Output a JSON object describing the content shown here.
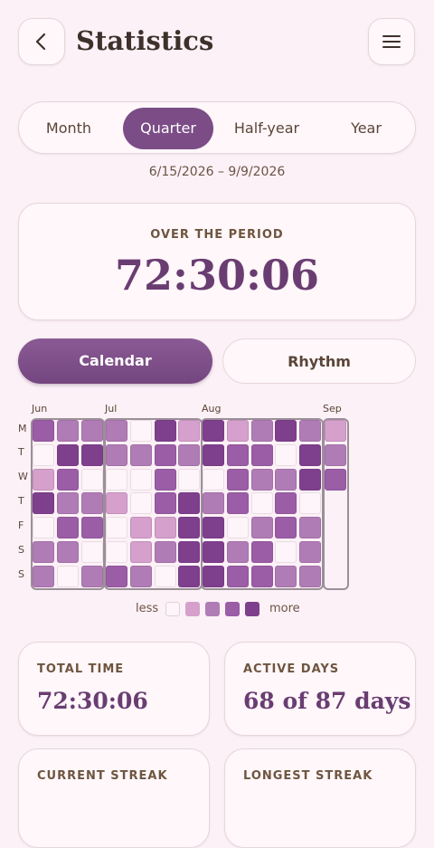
{
  "header": {
    "title": "Statistics"
  },
  "segments": [
    {
      "label": "Month",
      "active": false
    },
    {
      "label": "Quarter",
      "active": true
    },
    {
      "label": "Half-year",
      "active": false
    },
    {
      "label": "Year",
      "active": false
    }
  ],
  "date_range": "6/15/2026 – 9/9/2026",
  "period": {
    "label": "OVER THE PERIOD",
    "value": "72:30:06"
  },
  "view_tabs": {
    "calendar": "Calendar",
    "rhythm": "Rhythm",
    "active": "calendar"
  },
  "heatmap": {
    "months": [
      "Jun",
      "Jul",
      "Aug",
      "Sep"
    ],
    "day_labels": [
      "M",
      "T",
      "W",
      "T",
      "F",
      "S",
      "S"
    ],
    "levels": [
      "#fdf5f9",
      "#d5a0cc",
      "#b07cb6",
      "#9a5da6",
      "#7e3f8d"
    ],
    "blocks": [
      {
        "columns": [
          [
            3,
            0,
            1,
            4,
            0,
            2,
            2
          ],
          [
            2,
            4,
            3,
            2,
            3,
            2,
            0
          ],
          [
            2,
            4,
            0,
            2,
            3,
            0,
            2
          ]
        ]
      },
      {
        "columns": [
          [
            2,
            2,
            0,
            1,
            0,
            0,
            3
          ],
          [
            0,
            2,
            0,
            0,
            1,
            1,
            2
          ],
          [
            4,
            3,
            3,
            3,
            1,
            2,
            0
          ],
          [
            1,
            2,
            0,
            4,
            4,
            4,
            4
          ]
        ]
      },
      {
        "columns": [
          [
            4,
            4,
            0,
            2,
            4,
            4,
            4
          ],
          [
            1,
            3,
            3,
            3,
            0,
            2,
            3
          ],
          [
            2,
            3,
            2,
            0,
            2,
            3,
            3
          ],
          [
            4,
            0,
            2,
            3,
            3,
            0,
            2
          ],
          [
            2,
            4,
            4,
            0,
            2,
            2,
            2
          ]
        ]
      },
      {
        "columns": [
          [
            1,
            2,
            3,
            -1,
            -1,
            -1,
            -1
          ]
        ]
      }
    ],
    "legend": {
      "less": "less",
      "more": "more"
    }
  },
  "stats": [
    {
      "label": "TOTAL TIME",
      "value": "72:30:06"
    },
    {
      "label": "ACTIVE DAYS",
      "value": "68 of 87 days"
    },
    {
      "label": "CURRENT STREAK",
      "value": ""
    },
    {
      "label": "LONGEST STREAK",
      "value": ""
    }
  ]
}
